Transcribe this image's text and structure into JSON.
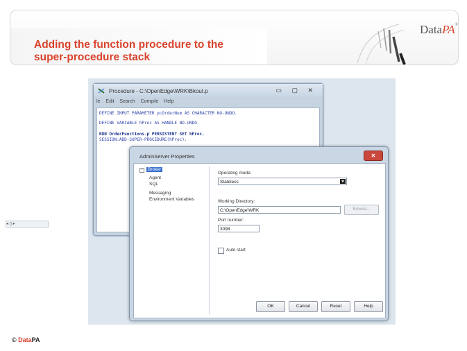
{
  "slide": {
    "title_line1": "Adding the function procedure to the",
    "title_line2": "super-procedure stack",
    "logo_text": "Data",
    "logo_pa": "PA",
    "logo_mark": "®",
    "footer_copyright": "© ",
    "footer_brand": "Data",
    "footer_pa": "PA"
  },
  "editor": {
    "title": "Procedure - C:\\OpenEdge\\WRK\\Bkout.p",
    "window_buttons": "▭ ▢ ✕",
    "menu": [
      "le",
      "Edit",
      "Search",
      "Compile",
      "Help"
    ],
    "code_lines": [
      "DEFINE INPUT PARAMETER pcOrderNum AS CHARACTER NO-UNDO.",
      "DEFINE VARIABLE hProc AS HANDLE NO-UNDO.",
      "RUN OrderFunctions.p PERSISTENT SET hProc.",
      "SESSION:ADD-SUPER-PROCEDURE(hProc)."
    ],
    "hscroll_label": "◂   ▯   ▸"
  },
  "dialog": {
    "title": "AdminServer Properties",
    "close_label": "✕",
    "tree_items": [
      "Broker",
      "Agent",
      "SQL",
      "Messaging",
      "Environment Variables"
    ],
    "operating_mode_label": "Operating mode:",
    "operating_mode_value": "Stateless",
    "working_directory_label": "Working Directory:",
    "working_directory_value": "C:\\OpenEdge\\WRK",
    "browse_label": "Browse...",
    "port_label": "Port number:",
    "port_value": "3098",
    "auto_start_label": "Auto start",
    "buttons": {
      "ok": "OK",
      "cancel": "Cancel",
      "reset": "Reset",
      "help": "Help"
    }
  }
}
